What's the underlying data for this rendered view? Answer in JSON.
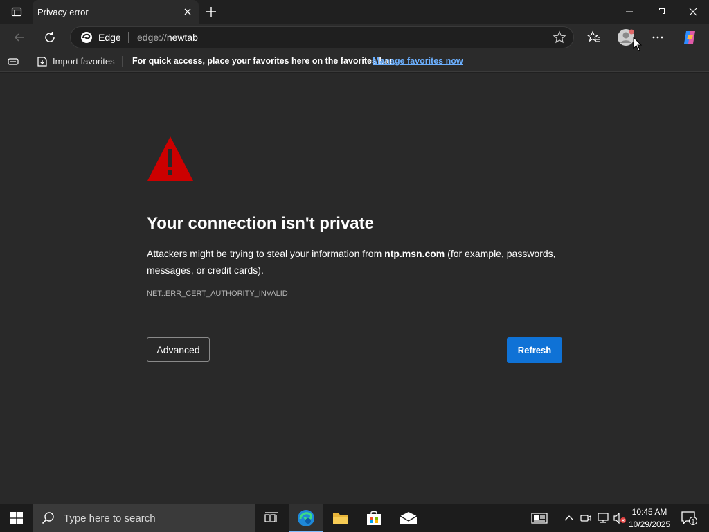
{
  "tab": {
    "title": "Privacy error",
    "close_icon": "close-icon",
    "new_tab_icon": "plus-icon"
  },
  "window_controls": [
    "minimize-icon",
    "restore-icon",
    "close-icon"
  ],
  "toolbar": {
    "back_icon": "back-arrow-icon",
    "refresh_icon": "refresh-icon",
    "site_name": "Edge",
    "url_scheme": "edge://",
    "url_path": "newtab",
    "favorites_icon": "favorites-icon",
    "profile_icon": "profile-icon",
    "more_icon": "more-icon",
    "copilot_icon": "copilot-icon"
  },
  "favorites_bar": {
    "import_label": "Import favorites",
    "message": "For quick access, place your favorites here on the favorites bar.",
    "manage_link": "Manage favorites now"
  },
  "error_page": {
    "heading": "Your connection isn't private",
    "description_before": "Attackers might be trying to steal your information from ",
    "host": "ntp.msn.com",
    "description_after": " (for example, passwords, messages, or credit cards).",
    "error_code": "NET::ERR_CERT_AUTHORITY_INVALID",
    "advanced_label": "Advanced",
    "refresh_label": "Refresh"
  },
  "taskbar": {
    "search_placeholder": "Type here to search",
    "apps": [
      "task-view-icon",
      "edge-icon",
      "file-explorer-icon",
      "store-icon",
      "mail-icon"
    ],
    "time": "10:45 AM",
    "date": "10/29/2025",
    "notification_count": "1"
  },
  "colors": {
    "accent": "#0f72d6",
    "warning": "#cc0000",
    "link": "#6cb0ff"
  }
}
